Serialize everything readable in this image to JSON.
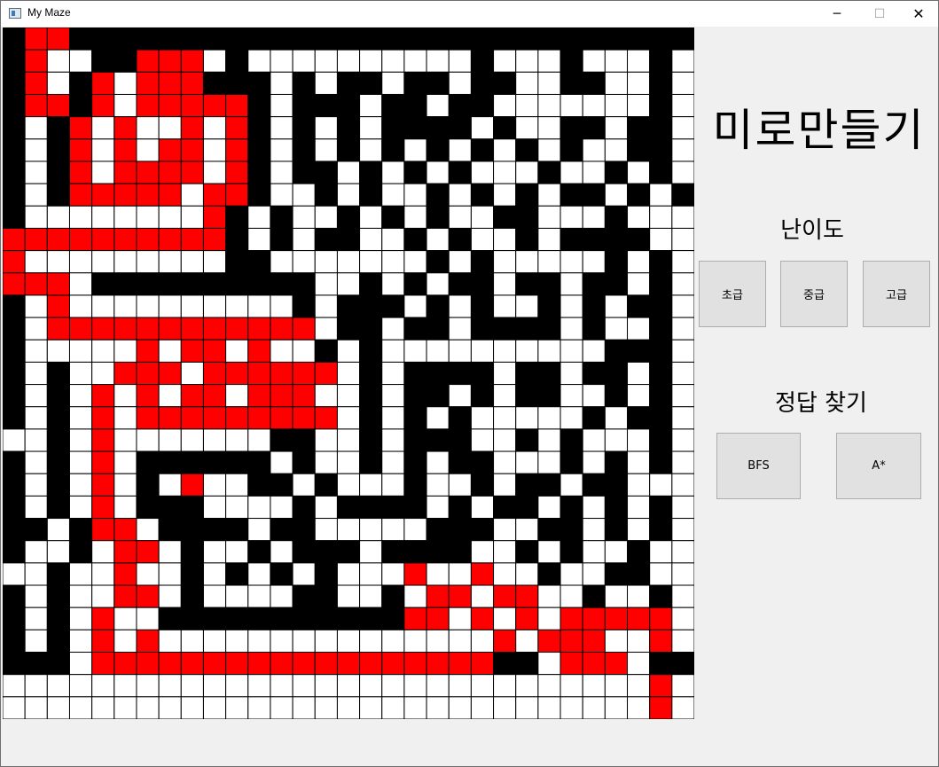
{
  "window": {
    "title": "My Maze",
    "minimize_glyph": "─",
    "maximize_glyph": "☐",
    "close_glyph": "✕",
    "icon": "app-icon"
  },
  "maze": {
    "rows": 31,
    "cols": 31,
    "colors": {
      "wall": "#000000",
      "path": "#ffffff",
      "solution": "#ff0000",
      "grid": "#000000"
    },
    "grid": [
      "#RR############################",
      "#R  ##RRR #          #   #   #",
      "#R #R RRR### # ## ## ##  ##  #",
      "#RR#R RRRRR# ### ## ##       #",
      "# #R R  R R# # # #### #  ## ##",
      "# #R R RR R# # # # # # # #  ##",
      "# #R RRRR R# ## # # #   #  # #",
      "# #RRRRR RR#  # #  # # # ## # #",
      "#        R# #  # # #  ##   #  ",
      "RRRRRRRRRR# # ##  # #  # #### ",
      "R         ##       # #     # #",
      "RRR ##########  # # ## ## ## #",
      "# R          # ### # #  # # ##",
      "# RRRRRRRRRRRR ## ## #### #  #",
      "#     R RR R  # #          ###",
      "# #  RRR RRRRRR # #### ## ## #",
      "# # R R RR RRR  # ## # ##  # #",
      "# # R RRRRRRRRR # # #     # ##",
      "  # R       ##  # ###  # #   #",
      "# # R ###### #  # # ##   # # #",
      "# # R # R  ## #   #  # ## ##  ",
      "# # R ###    # #### # ## # # #",
      "## #RR #### ##     ###  ## # #",
      "#  # RR #  # ### ####  # #  #",
      "  #  R  # # # #   R  R  #  ##",
      "# #  RR #    ##  # RR RR  #  #",
      "# # R  ###########RR R R RRRRR",
      "# # R R               R RRR  R",
      "### RRRRRRRRRRRRRRRRRR## RRR ##R",
      "                             R ",
      "                             R "
    ]
  },
  "panel": {
    "title": "미로만들기",
    "difficulty_label": "난이도",
    "buttons": {
      "easy": "초급",
      "medium": "중급",
      "hard": "고급"
    },
    "solve_label": "정답 찾기",
    "solvers": {
      "bfs": "BFS",
      "astar": "A*"
    }
  }
}
